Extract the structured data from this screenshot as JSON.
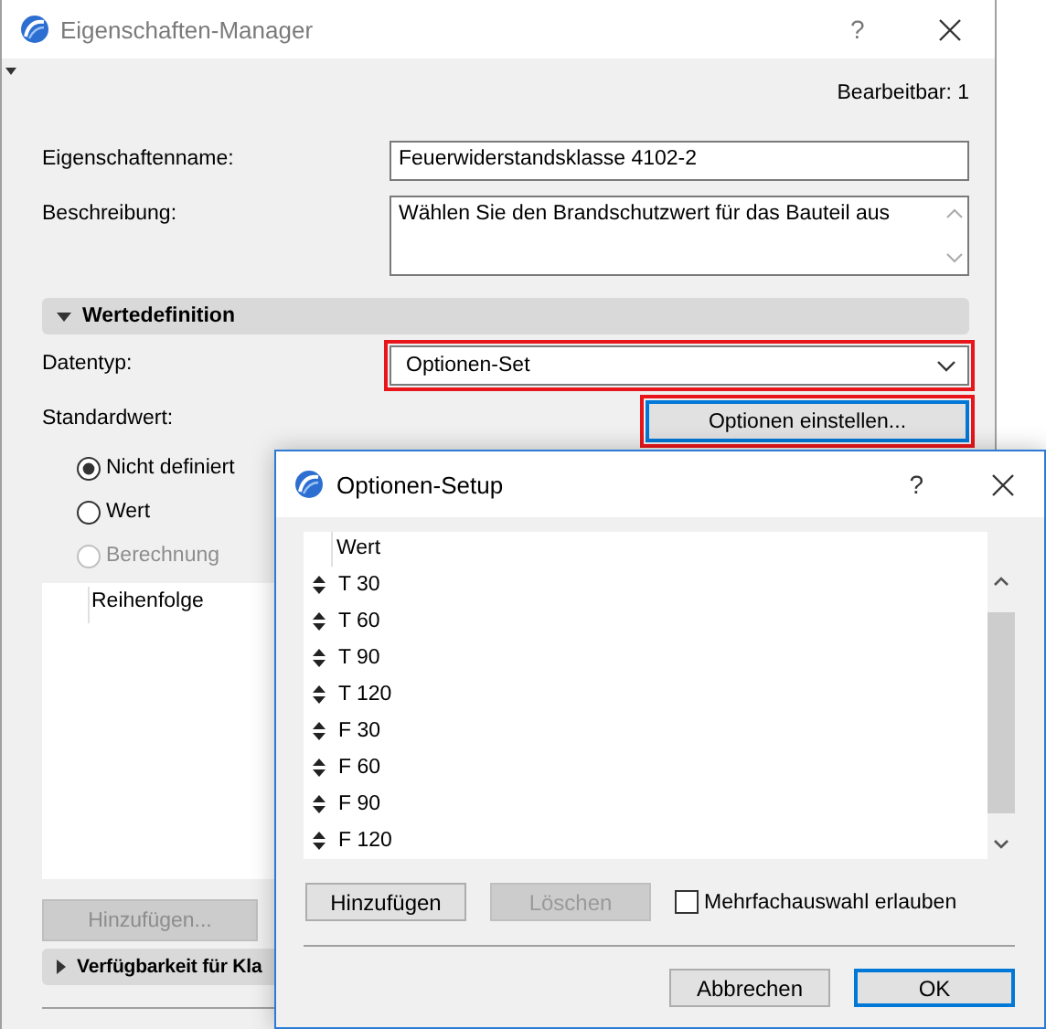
{
  "main_window": {
    "title": "Eigenschaften-Manager",
    "help": "?",
    "editable_count": "Bearbeitbar: 1",
    "fields": [
      {
        "kind": "text",
        "label": "Eigenschaftenname:",
        "value": "Feuerwiderstandsklasse 4102-2"
      },
      {
        "kind": "textarea",
        "label": "Beschreibung:",
        "value": "Wählen Sie den Brandschutzwert für das Bauteil aus"
      }
    ],
    "value_definition": {
      "title": "Wertedefinition",
      "expanded": true,
      "datatype": {
        "label": "Datentyp:",
        "value": "Optionen-Set",
        "highlighted": true
      },
      "default_value": {
        "label": "Standardwert:",
        "button": {
          "label": "Optionen einstellen...",
          "highlighted": true,
          "focused": true
        }
      },
      "radios": [
        {
          "label": "Nicht definiert",
          "selected": true,
          "disabled": false
        },
        {
          "label": "Wert",
          "selected": false,
          "disabled": false
        },
        {
          "label": "Berechnung",
          "selected": false,
          "disabled": true
        }
      ],
      "order_list": {
        "column": "Reihenfolge"
      },
      "add_button": {
        "label": "Hinzufügen...",
        "disabled": true
      }
    },
    "availability": {
      "title": "Verfügbarkeit für Kla",
      "expanded": false
    }
  },
  "options_dialog": {
    "title": "Optionen-Setup",
    "help": "?",
    "list": {
      "column": "Wert",
      "rows": [
        "T 30",
        "T 60",
        "T 90",
        "T 120",
        "F 30",
        "F 60",
        "F 90",
        "F 120"
      ]
    },
    "buttons": [
      {
        "label": "Hinzufügen",
        "disabled": false
      },
      {
        "label": "Löschen",
        "disabled": true
      }
    ],
    "multi_select": {
      "label": "Mehrfachauswahl erlauben",
      "checked": false
    },
    "footer_buttons": [
      {
        "label": "Abbrechen",
        "default": false
      },
      {
        "label": "OK",
        "default": true
      }
    ]
  }
}
